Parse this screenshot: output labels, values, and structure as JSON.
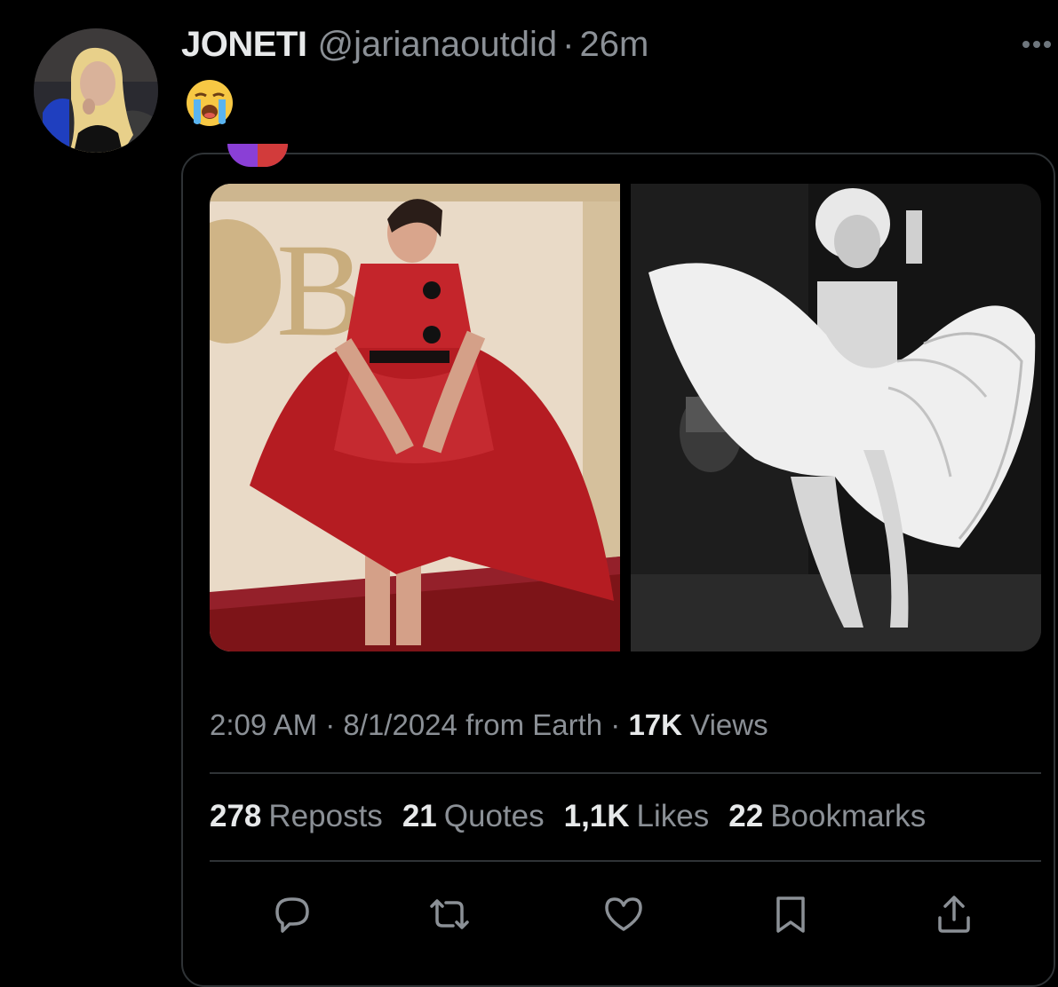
{
  "post": {
    "display_name": "JONETI",
    "handle": "@jarianaoutdid",
    "separator": "·",
    "age": "26m",
    "more_icon": "more-horizontal-icon",
    "text_emoji": "loudly-crying-face"
  },
  "quoted_post": {
    "media": [
      {
        "name": "red-dress-photo"
      },
      {
        "name": "white-dress-photo"
      }
    ]
  },
  "meta": {
    "time": "2:09 AM",
    "sep1": "·",
    "date": "8/1/2024",
    "source": "from Earth",
    "sep2": "·",
    "views_count": "17K",
    "views_label": "Views"
  },
  "stats": [
    {
      "count": "278",
      "label": "Reposts"
    },
    {
      "count": "21",
      "label": "Quotes"
    },
    {
      "count": "1,1K",
      "label": "Likes"
    },
    {
      "count": "22",
      "label": "Bookmarks"
    }
  ],
  "actions": [
    {
      "name": "reply-icon"
    },
    {
      "name": "repost-icon"
    },
    {
      "name": "like-icon"
    },
    {
      "name": "bookmark-icon"
    },
    {
      "name": "share-icon"
    }
  ],
  "colors": {
    "background": "#000000",
    "primary_text": "#e7e9ea",
    "secondary_text": "#8b9096",
    "border": "#2f3336",
    "icon": "#8b9096"
  }
}
